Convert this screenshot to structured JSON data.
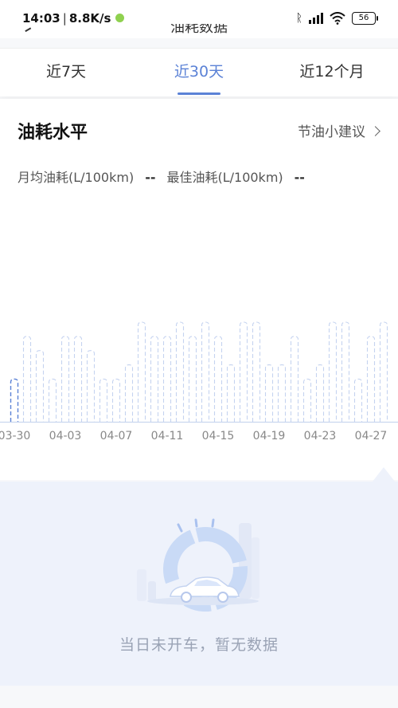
{
  "status_bar": {
    "time": "14:03",
    "net_speed": "8.8K/s",
    "battery": "56"
  },
  "header": {
    "title": "油耗数据"
  },
  "tabs": [
    {
      "label": "近7天",
      "active": false
    },
    {
      "label": "近30天",
      "active": true
    },
    {
      "label": "近12个月",
      "active": false
    }
  ],
  "section": {
    "title": "油耗水平",
    "tips_label": "节油小建议"
  },
  "metrics": {
    "monthly_avg_label": "月均油耗(L/100km)",
    "monthly_avg_value": "--",
    "best_label": "最佳油耗(L/100km)",
    "best_value": "--"
  },
  "chart_data": {
    "type": "bar",
    "categories": [
      "03-30",
      "03-31",
      "04-01",
      "04-02",
      "04-03",
      "04-04",
      "04-05",
      "04-06",
      "04-07",
      "04-08",
      "04-09",
      "04-10",
      "04-11",
      "04-12",
      "04-13",
      "04-14",
      "04-15",
      "04-16",
      "04-17",
      "04-18",
      "04-19",
      "04-20",
      "04-21",
      "04-22",
      "04-23",
      "04-24",
      "04-25",
      "04-26",
      "04-27",
      "04-28"
    ],
    "tick_labels": [
      "03-30",
      "04-03",
      "04-07",
      "04-11",
      "04-15",
      "04-19",
      "04-23",
      "04-27"
    ],
    "values": [
      30,
      60,
      50,
      30,
      60,
      60,
      50,
      30,
      30,
      40,
      70,
      60,
      60,
      70,
      60,
      70,
      60,
      40,
      70,
      70,
      40,
      40,
      60,
      30,
      40,
      70,
      70,
      30,
      60,
      70
    ],
    "selected_index": 0,
    "style": "dashed-outline",
    "colors": {
      "bar_outline": "#c5d3f0",
      "selected_outline": "#5b82d6",
      "axis": "#c9d6ef"
    }
  },
  "empty_state": {
    "message": "当日未开车，暂无数据",
    "illustration": "car-gauge-illustration"
  }
}
